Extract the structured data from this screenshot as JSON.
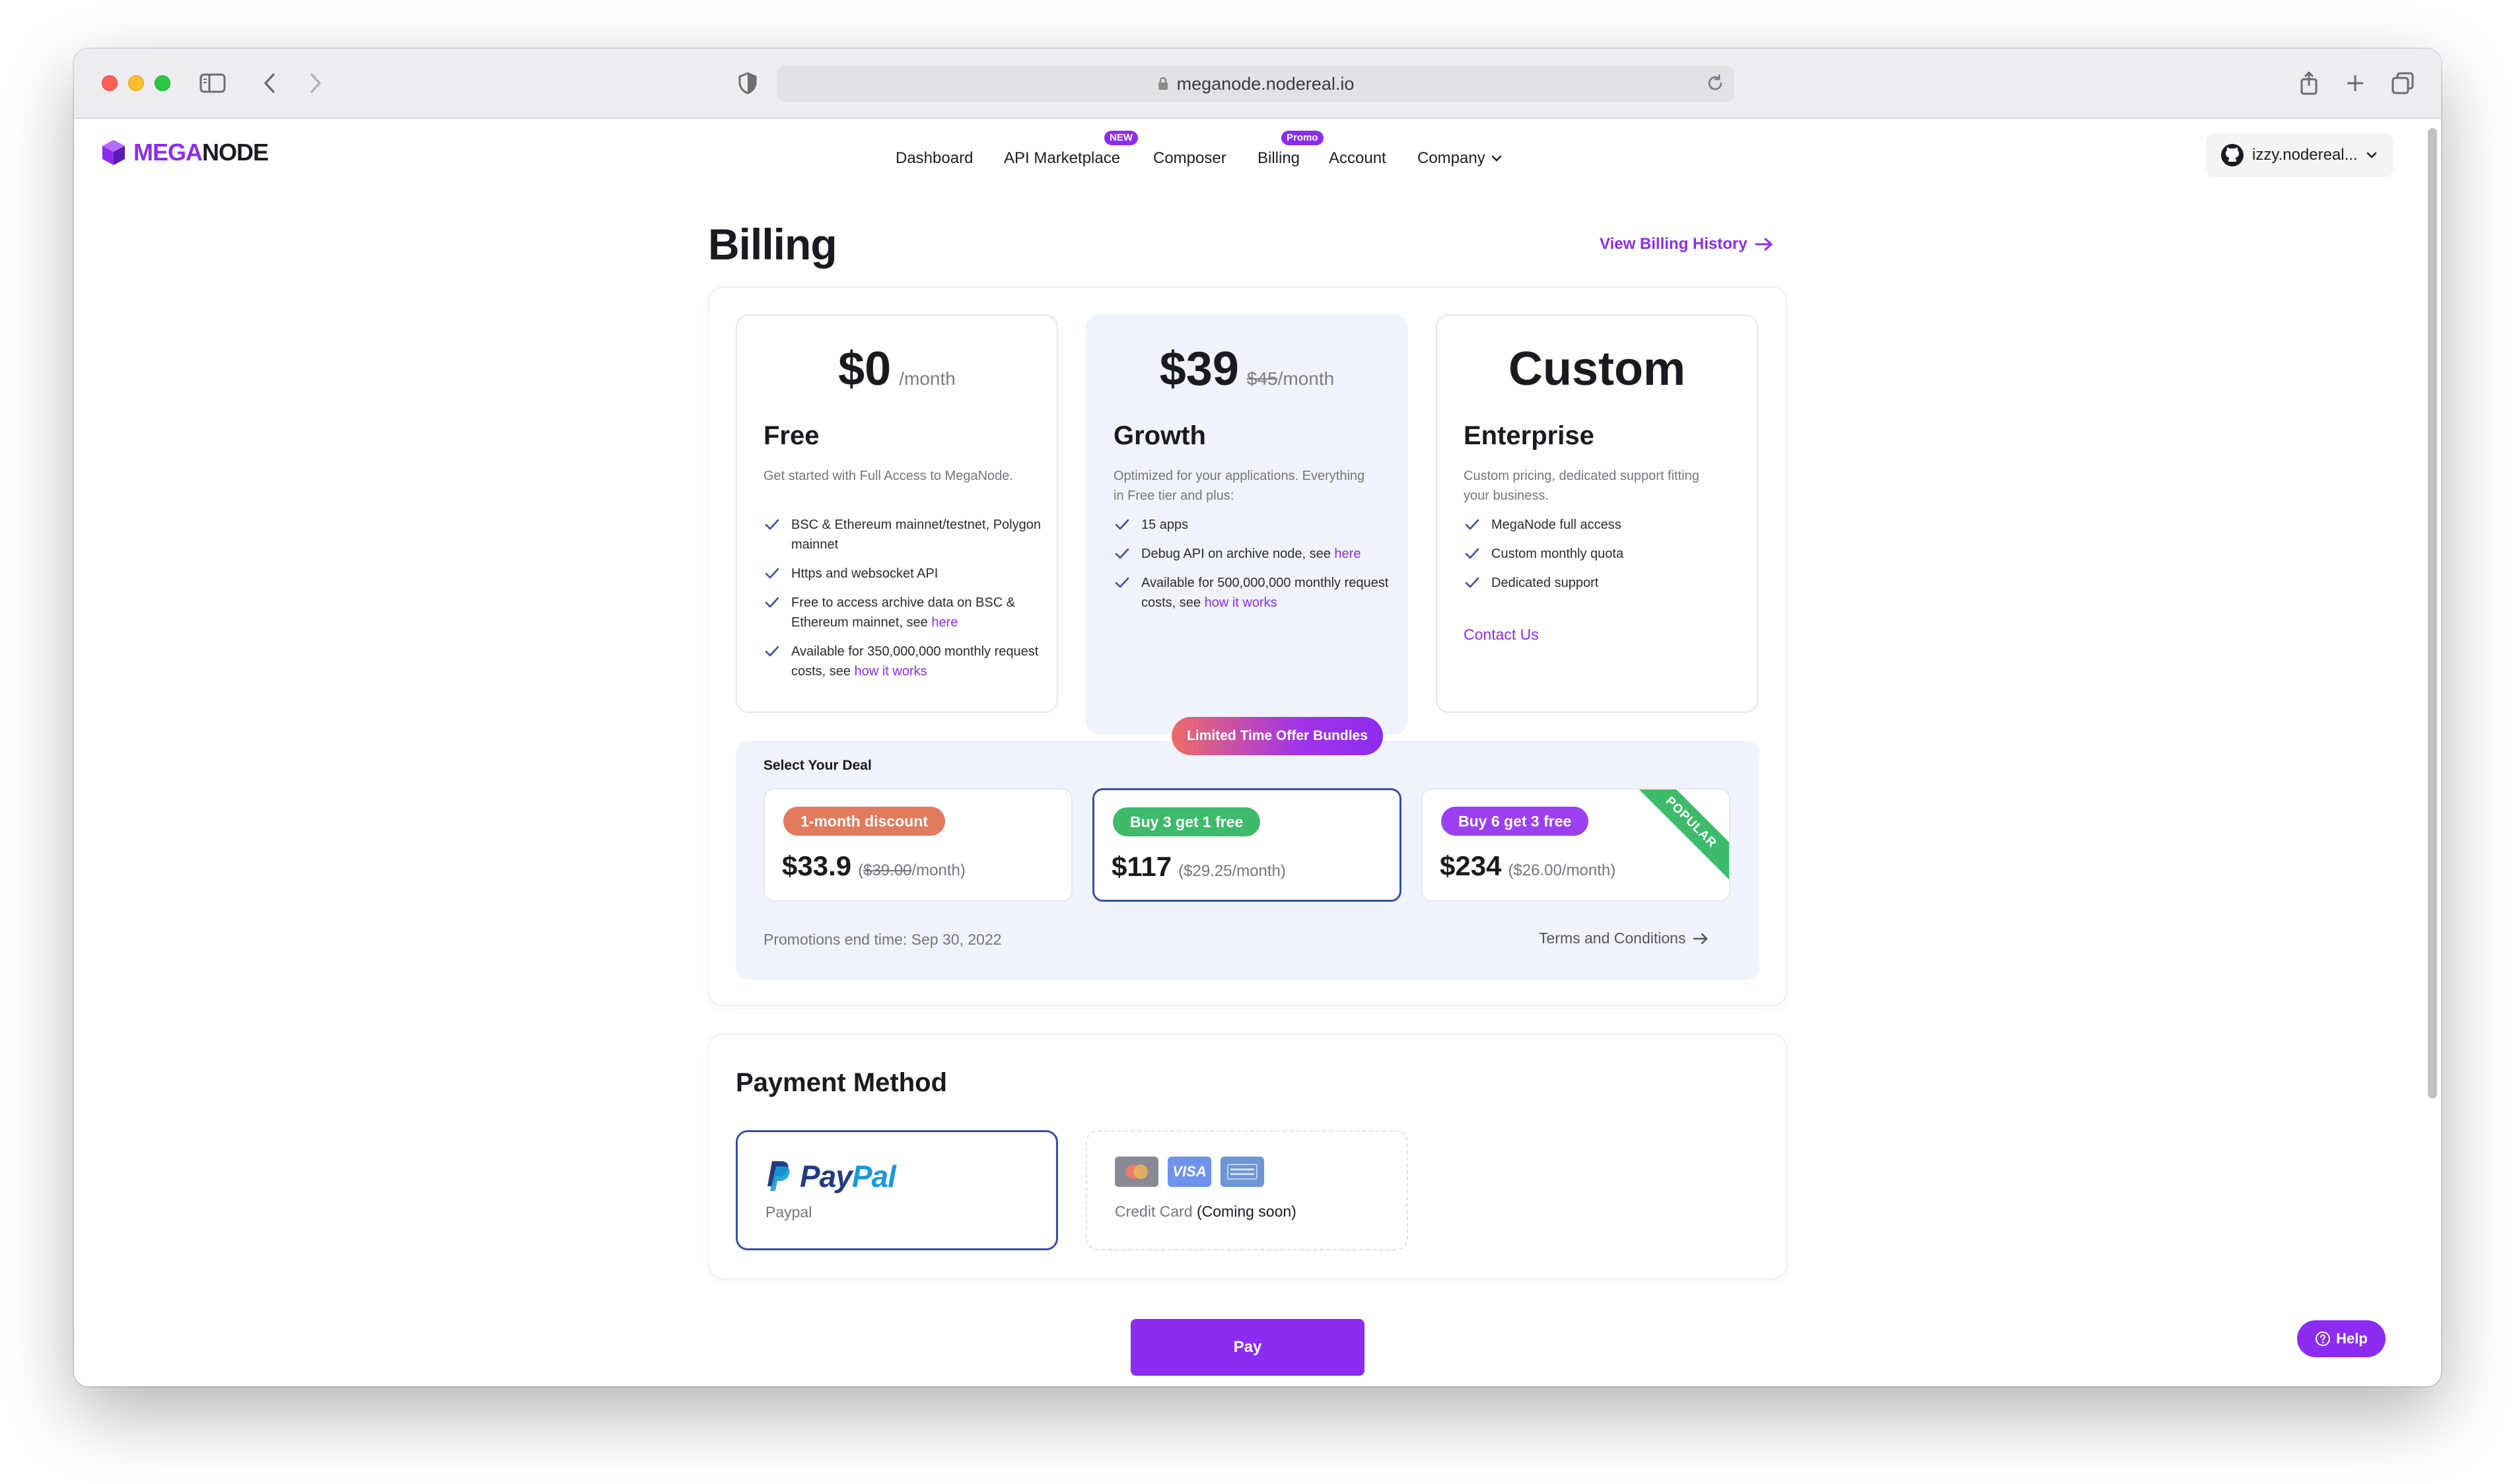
{
  "browser": {
    "url": "meganode.nodereal.io"
  },
  "header": {
    "logo_mega": "MEGA",
    "logo_node": "NODE",
    "nav": [
      {
        "label": "Dashboard",
        "badge": ""
      },
      {
        "label": "API Marketplace",
        "badge": "NEW"
      },
      {
        "label": "Composer",
        "badge": ""
      },
      {
        "label": "Billing",
        "badge": "Promo"
      },
      {
        "label": "Account",
        "badge": ""
      },
      {
        "label": "Company",
        "badge": ""
      }
    ],
    "user": "izzy.nodereal..."
  },
  "page": {
    "title": "Billing",
    "history_link": "View Billing History"
  },
  "plans": [
    {
      "price": "$0",
      "old_price": "",
      "suffix": "/month",
      "name": "Free",
      "description": "Get started with Full Access to MegaNode.",
      "features": [
        {
          "text": "BSC & Ethereum mainnet/testnet, Polygon mainnet",
          "link": ""
        },
        {
          "text": "Https and websocket API",
          "link": ""
        },
        {
          "text": "Free to access archive data on BSC & Ethereum mainnet, see ",
          "link": "here"
        },
        {
          "text": "Available for 350,000,000 monthly request costs, see ",
          "link": "how it works"
        }
      ]
    },
    {
      "price": "$39",
      "old_price": "$45",
      "suffix": "/month",
      "name": "Growth",
      "description": "Optimized for your applications. Everything in Free tier and plus:",
      "features": [
        {
          "text": "15 apps",
          "link": ""
        },
        {
          "text": "Debug API on archive node, see ",
          "link": "here"
        },
        {
          "text": "Available for 500,000,000 monthly request costs, see ",
          "link": "how it works"
        }
      ]
    },
    {
      "price": "Custom",
      "old_price": "",
      "suffix": "",
      "name": "Enterprise",
      "description": "Custom pricing, dedicated support fitting your business.",
      "features": [
        {
          "text": "MegaNode full access",
          "link": ""
        },
        {
          "text": "Custom monthly quota",
          "link": ""
        },
        {
          "text": "Dedicated support",
          "link": ""
        }
      ],
      "cta": "Contact Us"
    }
  ],
  "deals": {
    "pill": "Limited Time Offer Bundles",
    "title": "Select Your Deal",
    "items": [
      {
        "badge": "1-month discount",
        "badge_color": "#e27a5e",
        "price": "$33.9",
        "old_price": "$39.00",
        "per_suffix": "/month)",
        "ribbon": ""
      },
      {
        "badge": "Buy 3 get 1 free",
        "badge_color": "#3dbb6a",
        "price": "$117",
        "old_price": "",
        "per_suffix": "($29.25/month)",
        "ribbon": ""
      },
      {
        "badge": "Buy 6 get 3 free",
        "badge_color": "#9b3ff0",
        "price": "$234",
        "old_price": "",
        "per_suffix": "($26.00/month)",
        "ribbon": "POPULAR"
      }
    ],
    "selected_index": 1,
    "promo_end": "Promotions end time: Sep 30, 2022",
    "terms": "Terms and Conditions"
  },
  "payment": {
    "title": "Payment Method",
    "paypal_pay": "Pay",
    "paypal_pal": "Pal",
    "paypal_label": "Paypal",
    "card_visa": "VISA",
    "card_label": "Credit Card ",
    "card_soon": "(Coming soon)"
  },
  "actions": {
    "pay": "Pay",
    "help": "Help"
  },
  "colors": {
    "accent": "#8c2cf0",
    "selected_border": "#3a4fa0",
    "growth_bg": "#f0f3fb"
  }
}
